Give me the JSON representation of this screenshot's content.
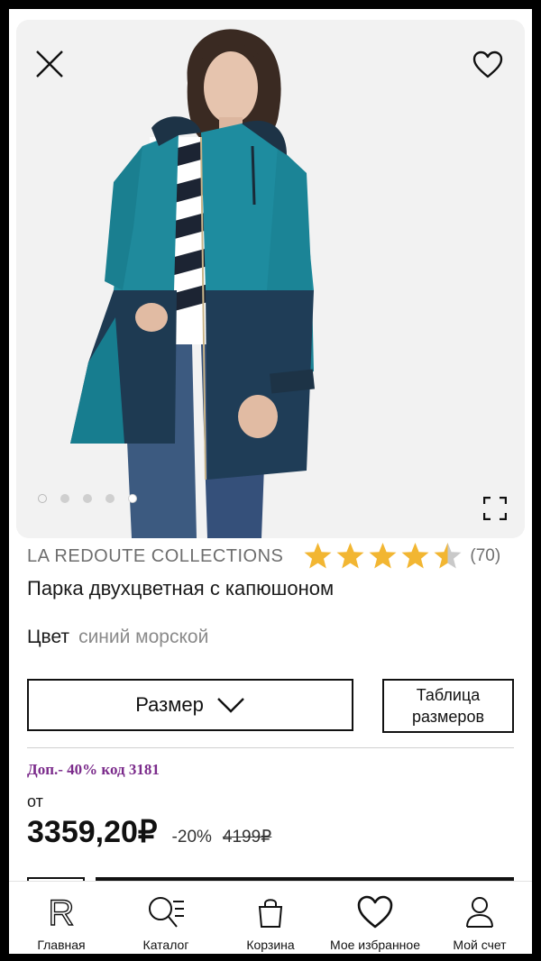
{
  "gallery": {
    "image_alt": "",
    "slide_count": 5,
    "active_slide": 5
  },
  "icons": {
    "close": "close-icon",
    "favorite": "heart-icon",
    "expand": "expand-icon"
  },
  "product": {
    "brand": "LA REDOUTE COLLECTIONS",
    "rating": 4.5,
    "rating_max": 5,
    "reviews": "(70)",
    "title": "Парка двухцветная с капюшоном",
    "color_label": "Цвет",
    "color_value": "синий морской"
  },
  "actions": {
    "size_label": "Размер",
    "size_table_label_1": "Таблица",
    "size_table_label_2": "размеров"
  },
  "pricing": {
    "promo": "Доп.- 40% код 3181",
    "from_label": "от",
    "price": "3359,20₽",
    "discount": "-20%",
    "old_price": "4199₽"
  },
  "colors": {
    "star": "#f2b632",
    "star_empty": "#c9c9c9",
    "promo": "#7b2b8b"
  },
  "tabbar": {
    "items": [
      {
        "label": "Главная",
        "icon": "home-r-icon"
      },
      {
        "label": "Каталог",
        "icon": "catalog-search-icon"
      },
      {
        "label": "Корзина",
        "icon": "bag-icon"
      },
      {
        "label": "Мое избранное",
        "icon": "heart-icon"
      },
      {
        "label": "Мой счет",
        "icon": "user-icon"
      }
    ]
  }
}
